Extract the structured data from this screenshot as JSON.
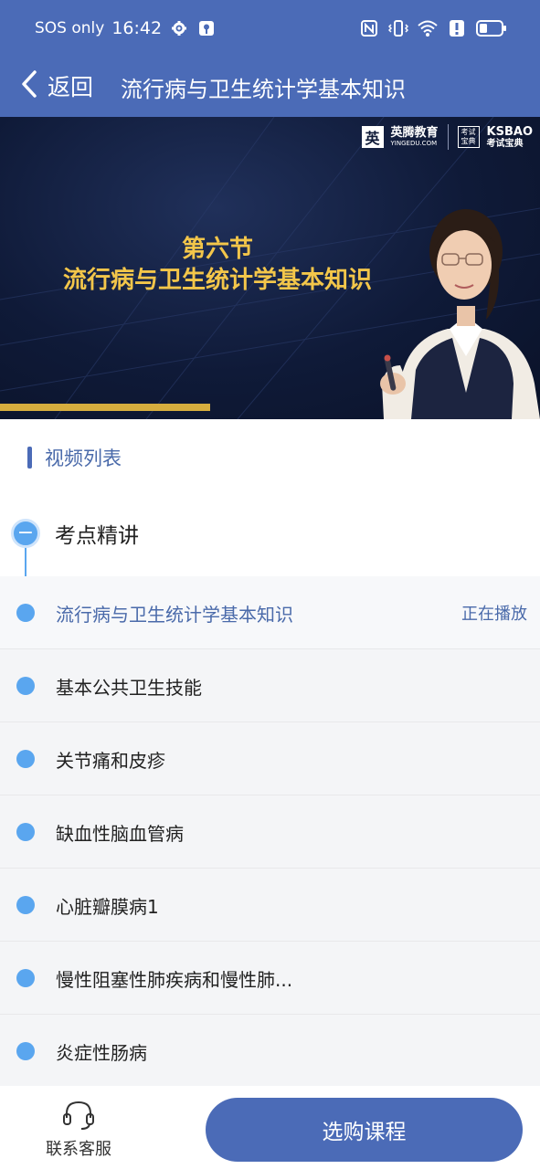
{
  "status_bar": {
    "carrier": "SOS only",
    "time": "16:42",
    "icons": [
      "gear-icon",
      "location-icon",
      "nfc-icon",
      "vibrate-icon",
      "wifi-icon",
      "alert-icon",
      "battery-icon"
    ]
  },
  "nav": {
    "back_label": "返回",
    "title": "流行病与卫生统计学基本知识"
  },
  "video": {
    "brand_cn": "英腾教育",
    "brand_url": "YINGEDU.COM",
    "brand2_box": "考试宝典",
    "brand2_en": "KSBAO",
    "brand2_cn": "考试宝典",
    "heading_line1": "第六节",
    "heading_line2": "流行病与卫生统计学基本知识"
  },
  "section": {
    "title": "视频列表"
  },
  "group": {
    "title": "考点精讲",
    "toggle_symbol": "−"
  },
  "items": [
    {
      "label": "流行病与卫生统计学基本知识",
      "status": "正在播放"
    },
    {
      "label": "基本公共卫生技能",
      "status": ""
    },
    {
      "label": "关节痛和皮疹",
      "status": ""
    },
    {
      "label": "缺血性脑血管病",
      "status": ""
    },
    {
      "label": "心脏瓣膜病1",
      "status": ""
    },
    {
      "label": "慢性阻塞性肺疾病和慢性肺...",
      "status": ""
    },
    {
      "label": "炎症性肠病",
      "status": ""
    }
  ],
  "bottom": {
    "service_label": "联系客服",
    "buy_label": "选购课程"
  },
  "colors": {
    "primary": "#4b6bb7",
    "accent_blue": "#5aa6ef",
    "heading_gold": "#f3c64a"
  }
}
